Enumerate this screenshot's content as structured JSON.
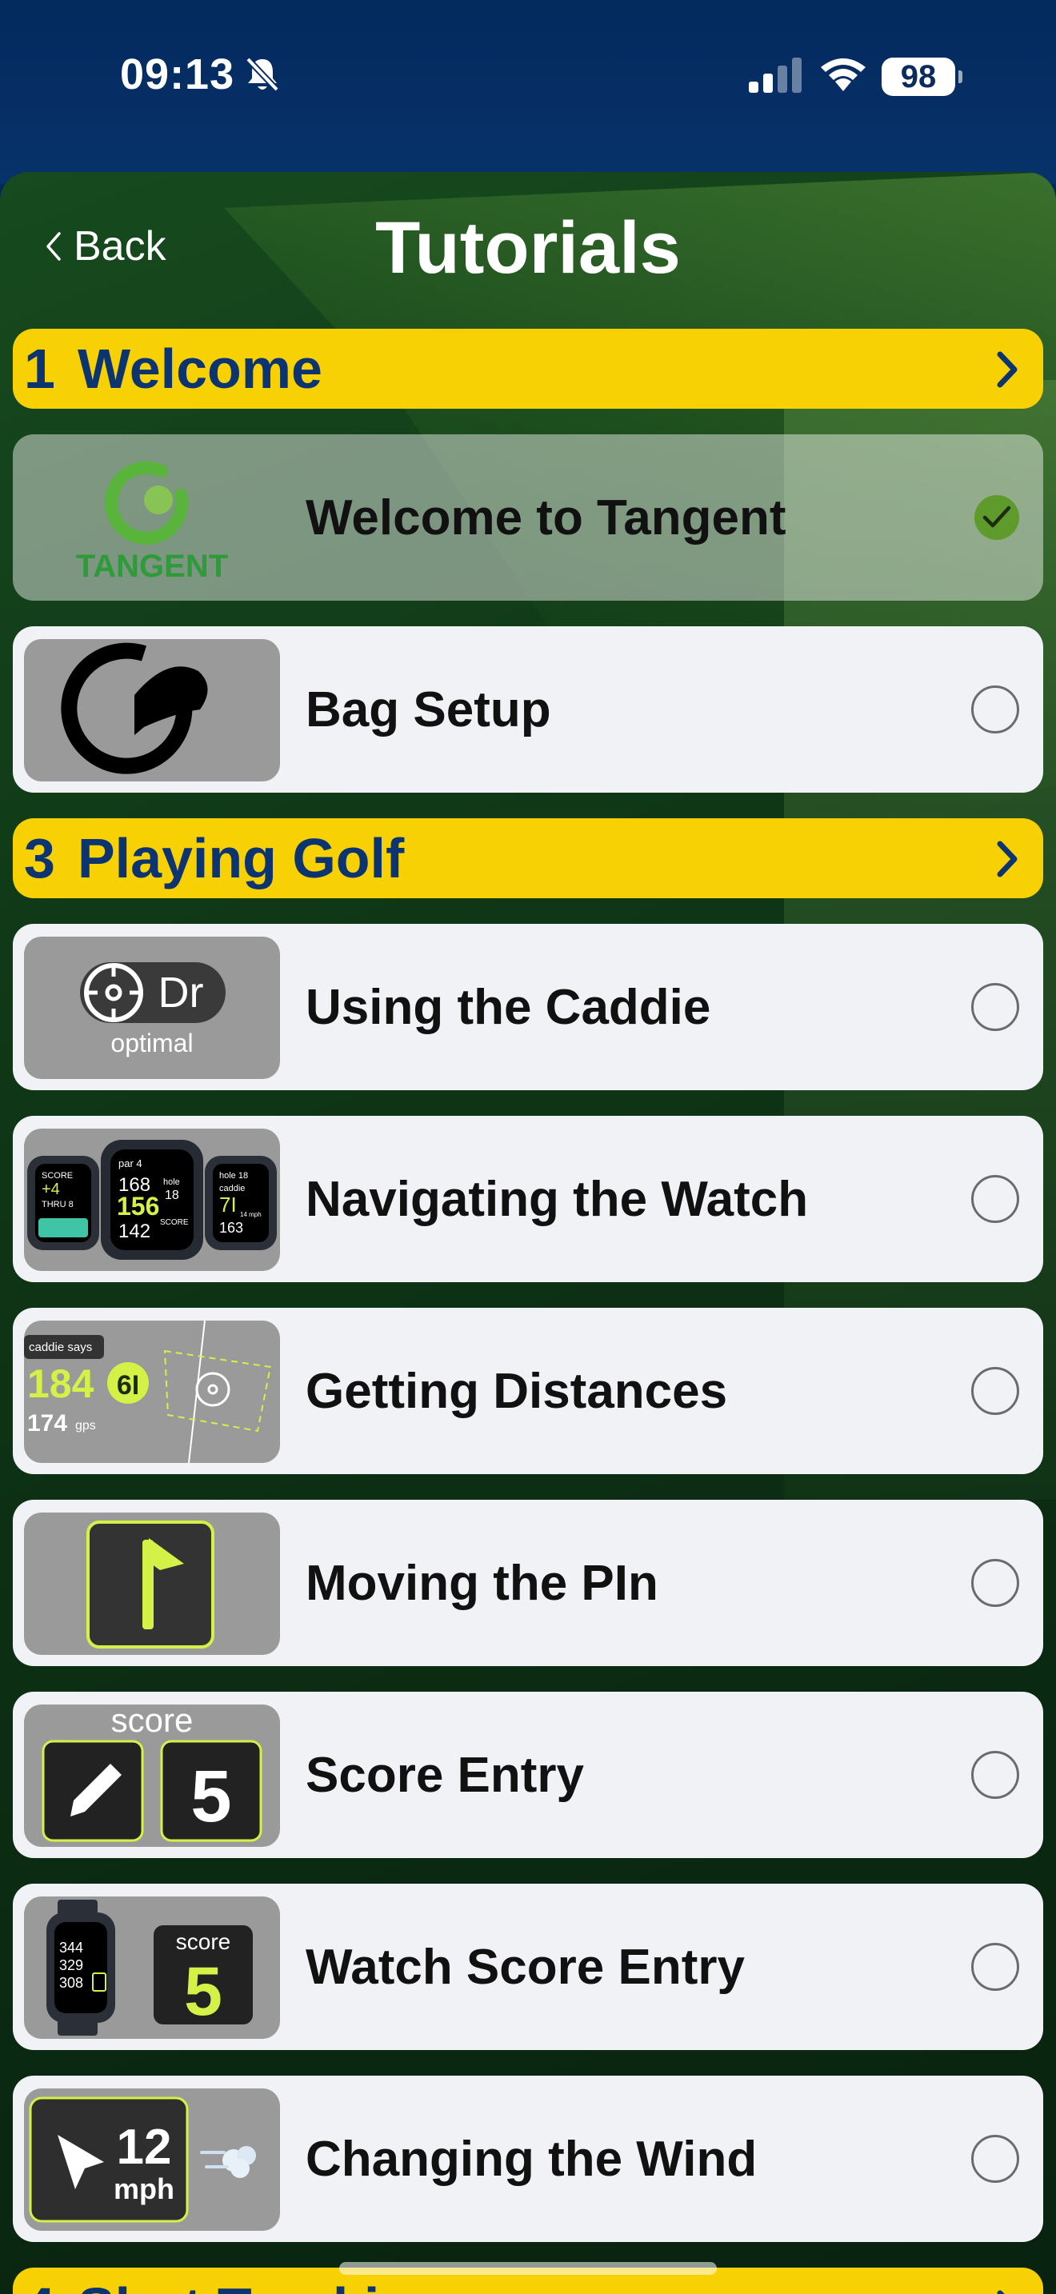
{
  "status": {
    "time": "09:13",
    "battery": "98"
  },
  "header": {
    "back_label": "Back",
    "title": "Tutorials"
  },
  "sections": [
    {
      "number": "1",
      "title": "Welcome"
    },
    {
      "number": "3",
      "title": "Playing Golf"
    },
    {
      "number": "4",
      "title": "Shot Tracking"
    }
  ],
  "rows": [
    {
      "label": "Welcome to Tangent",
      "completed": true,
      "icon": "tangent-logo-icon",
      "logo_text": "TANGENT"
    },
    {
      "label": "Bag Setup",
      "completed": false,
      "icon": "bag-setup-icon"
    },
    {
      "label": "Using the Caddie",
      "completed": false,
      "icon": "caddie-icon",
      "thumb_text": "Dr",
      "thumb_sub": "optimal"
    },
    {
      "label": "Navigating the Watch",
      "completed": false,
      "icon": "watch-faces-icon",
      "watch_left": [
        "SCORE",
        "+4",
        "THRU 8"
      ],
      "watch_mid": [
        "par 4",
        "168",
        "156",
        "142",
        "hole",
        "18",
        "SCORE"
      ],
      "watch_right": [
        "hole 18",
        "caddie",
        "7I",
        "163",
        "14 mph"
      ]
    },
    {
      "label": "Getting Distances",
      "completed": false,
      "icon": "distances-icon",
      "caddie_says": "caddie says",
      "distance": "184",
      "club": "6I",
      "gps": "174",
      "gps_unit": "gps"
    },
    {
      "label": "Moving the PIn",
      "completed": false,
      "icon": "pin-flag-icon"
    },
    {
      "label": "Score Entry",
      "completed": false,
      "icon": "score-entry-icon",
      "thumb_title": "score",
      "score": "5"
    },
    {
      "label": "Watch Score Entry",
      "completed": false,
      "icon": "watch-score-icon",
      "watch_lines": [
        "344",
        "329",
        "308"
      ],
      "score_label": "score",
      "score": "5"
    },
    {
      "label": "Changing the Wind",
      "completed": false,
      "icon": "wind-icon",
      "wind_speed": "12",
      "wind_unit": "mph"
    }
  ],
  "colors": {
    "accent_yellow": "#f7d104",
    "navy": "#0c3470",
    "lime": "#d4f148",
    "check_green": "#5e9b2c"
  }
}
